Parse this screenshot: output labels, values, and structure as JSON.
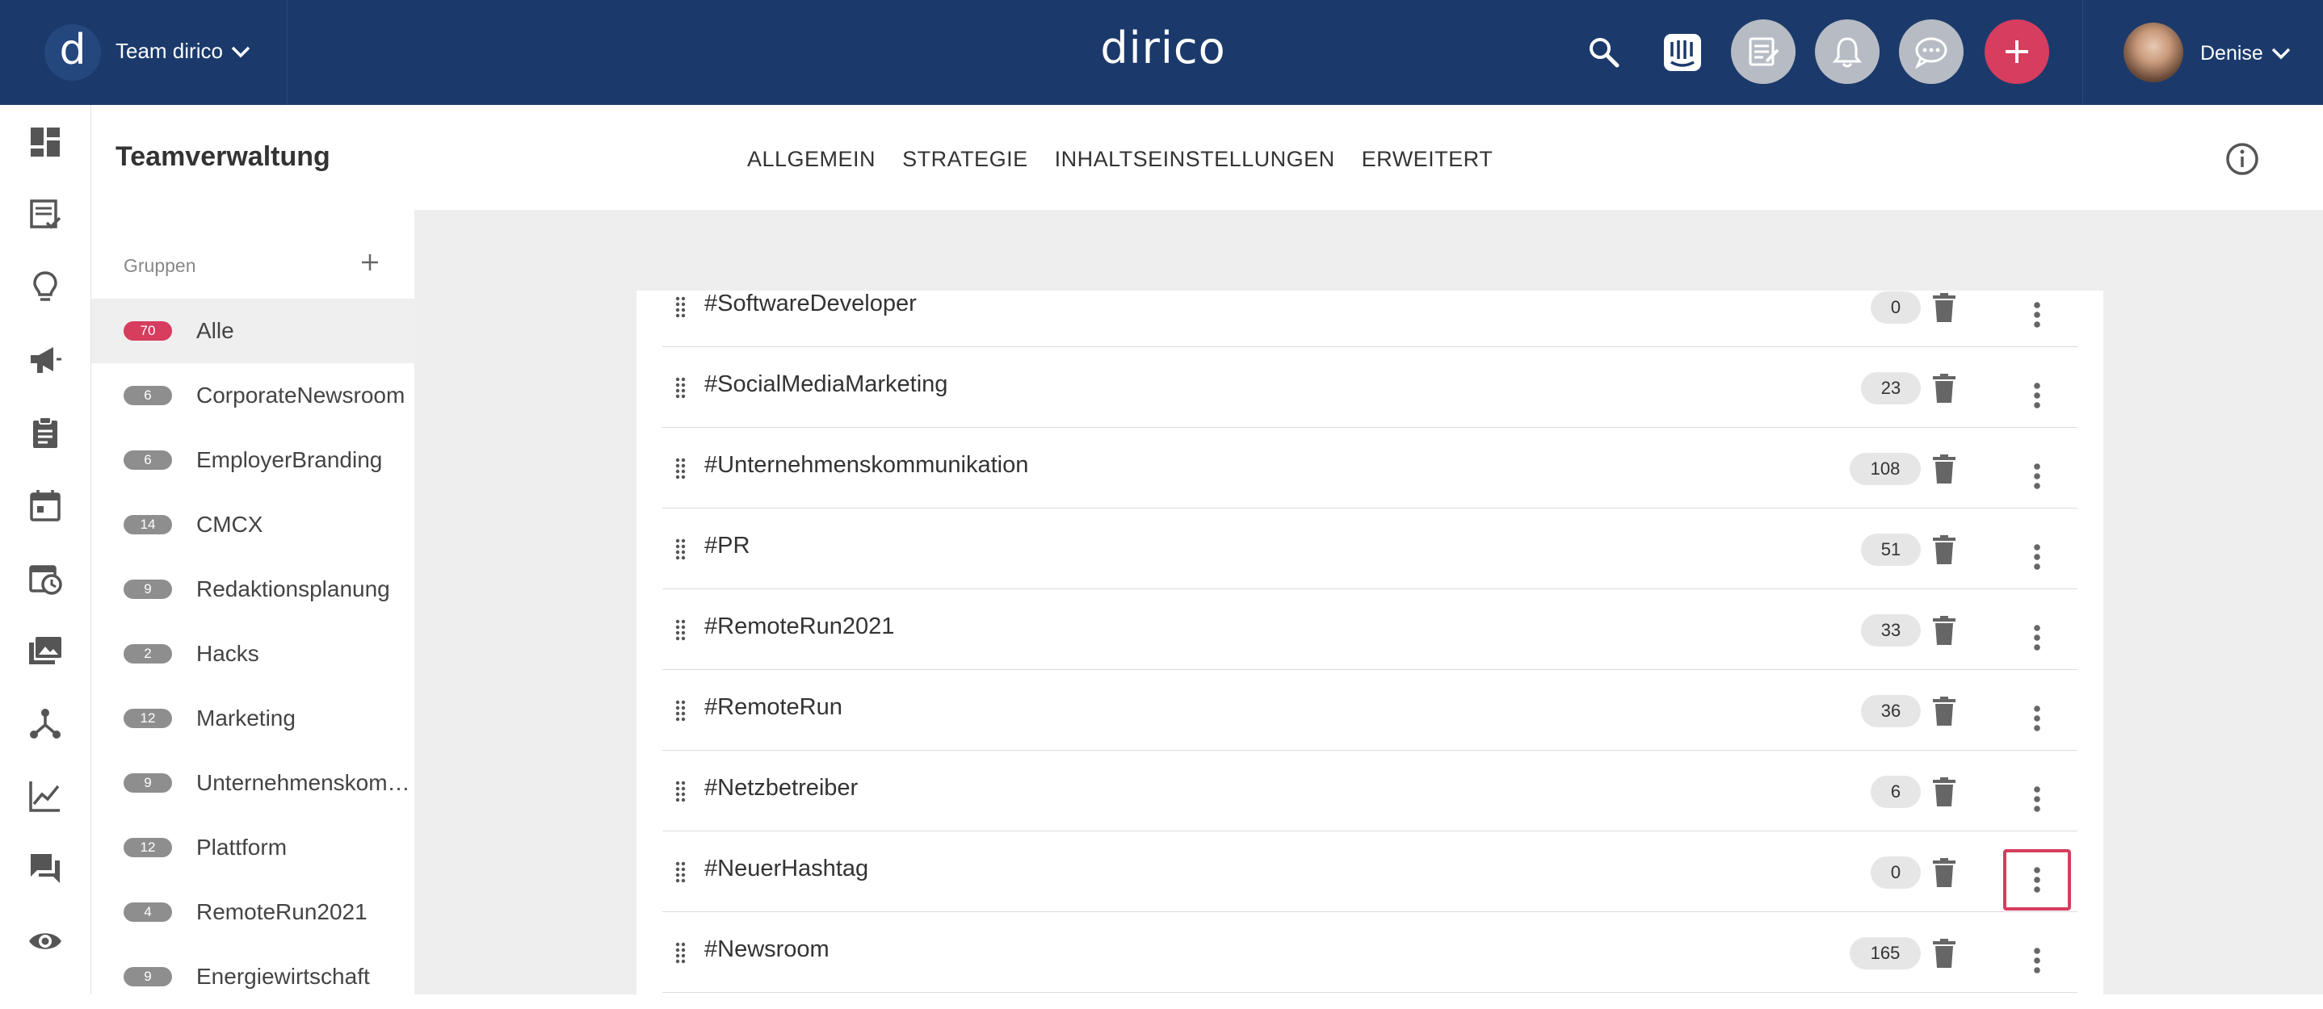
{
  "header": {
    "logo_letter": "d",
    "team_name": "Team dirico",
    "brand": "dirico",
    "user_name": "Denise",
    "icons": [
      "search-icon",
      "intercom-icon",
      "notes-icon",
      "bell-icon",
      "chat-icon",
      "plus-icon"
    ],
    "accent_color": "#d63d5e",
    "bar_color": "#1b3a6b"
  },
  "left_nav": [
    "dashboard-icon",
    "posts-icon",
    "ideas-icon",
    "campaign-icon",
    "clipboard-icon",
    "calendar-icon",
    "schedule-icon",
    "media-icon",
    "network-icon",
    "analytics-icon",
    "messages-icon",
    "eye-icon"
  ],
  "page": {
    "title": "Teamverwaltung",
    "tabs": [
      "ALLGEMEIN",
      "STRATEGIE",
      "INHALTSEINSTELLUNGEN",
      "ERWEITERT"
    ]
  },
  "groups": {
    "heading": "Gruppen",
    "items": [
      {
        "count": "70",
        "label": "Alle"
      },
      {
        "count": "6",
        "label": "CorporateNewsroom"
      },
      {
        "count": "6",
        "label": "EmployerBranding"
      },
      {
        "count": "14",
        "label": "CMCX"
      },
      {
        "count": "9",
        "label": "Redaktionsplanung"
      },
      {
        "count": "2",
        "label": "Hacks"
      },
      {
        "count": "12",
        "label": "Marketing"
      },
      {
        "count": "9",
        "label": "Unternehmenskom…"
      },
      {
        "count": "12",
        "label": "Plattform"
      },
      {
        "count": "4",
        "label": "RemoteRun2021"
      },
      {
        "count": "9",
        "label": "Energiewirtschaft"
      }
    ]
  },
  "hashtags": [
    {
      "tag": "#SoftwareDeveloper",
      "count": "0"
    },
    {
      "tag": "#SocialMediaMarketing",
      "count": "23"
    },
    {
      "tag": "#Unternehmenskommunikation",
      "count": "108"
    },
    {
      "tag": "#PR",
      "count": "51"
    },
    {
      "tag": "#RemoteRun2021",
      "count": "33"
    },
    {
      "tag": "#RemoteRun",
      "count": "36"
    },
    {
      "tag": "#Netzbetreiber",
      "count": "6"
    },
    {
      "tag": "#NeuerHashtag",
      "count": "0"
    },
    {
      "tag": "#Newsroom",
      "count": "165"
    }
  ]
}
